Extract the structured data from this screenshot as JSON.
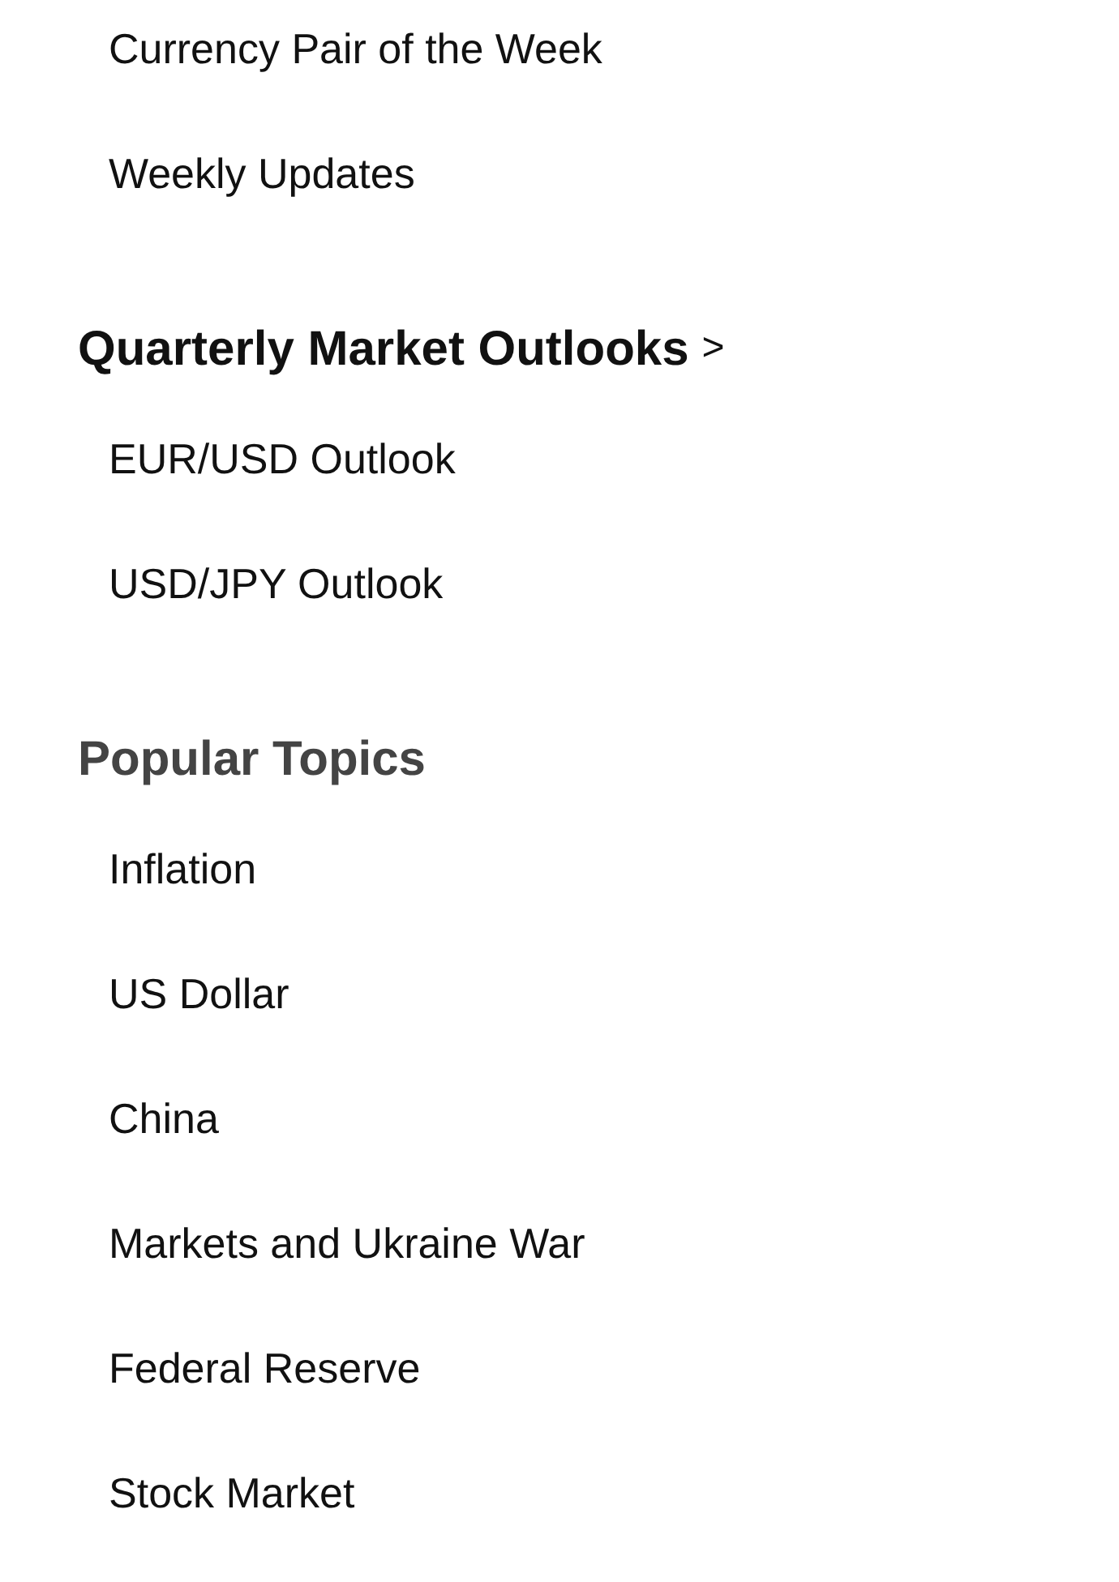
{
  "sections": [
    {
      "items": [
        "Currency Pair of the Week",
        "Weekly Updates"
      ]
    },
    {
      "heading": "Quarterly Market Outlooks",
      "kind": "link",
      "chevron": ">",
      "items": [
        "EUR/USD Outlook",
        "USD/JPY Outlook"
      ]
    },
    {
      "heading": "Popular Topics",
      "kind": "plain",
      "items": [
        "Inflation",
        "US Dollar",
        "China",
        "Markets and Ukraine War",
        "Federal Reserve",
        "Stock Market"
      ]
    }
  ]
}
